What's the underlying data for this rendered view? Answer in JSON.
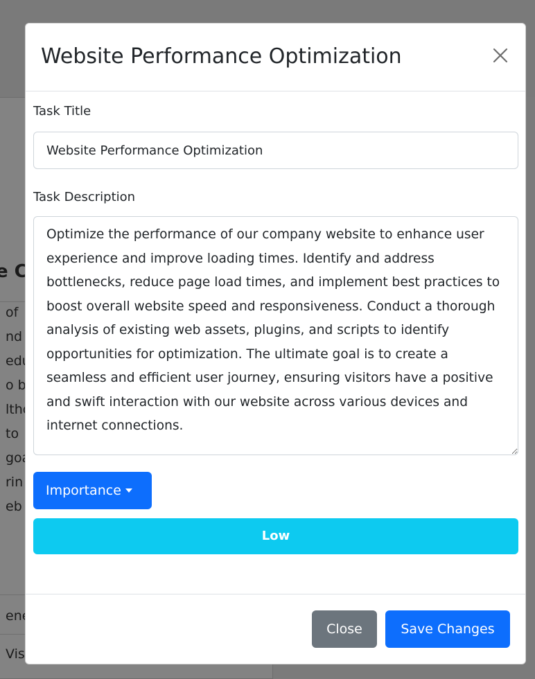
{
  "background": {
    "heading_fragment": "e C",
    "text_fragments": [
      "of",
      "nd",
      "edu",
      "o b",
      "ltho",
      "to",
      "goa",
      "rin",
      "eb"
    ],
    "footer_fragments": [
      "ene",
      "Vis"
    ]
  },
  "modal": {
    "title": "Website Performance Optimization",
    "close_icon": "close-icon",
    "task_title_label": "Task Title",
    "task_title_value": "Website Performance Optimization",
    "task_description_label": "Task Description",
    "task_description_value": "Optimize the performance of our company website to enhance user experience and improve loading times. Identify and address bottlenecks, reduce page load times, and implement best practices to boost overall website speed and responsiveness. Conduct a thorough analysis of existing web assets, plugins, and scripts to identify opportunities for optimization. The ultimate goal is to create a seamless and efficient user journey, ensuring visitors have a positive and swift interaction with our website across various devices and internet connections.",
    "importance_button_label": "Importance",
    "importance_value": "Low",
    "close_button_label": "Close",
    "save_button_label": "Save Changes"
  },
  "colors": {
    "primary": "#0d6efd",
    "secondary": "#6c757d",
    "info": "#0dcaf0",
    "backdrop": "#7b7b7b"
  }
}
